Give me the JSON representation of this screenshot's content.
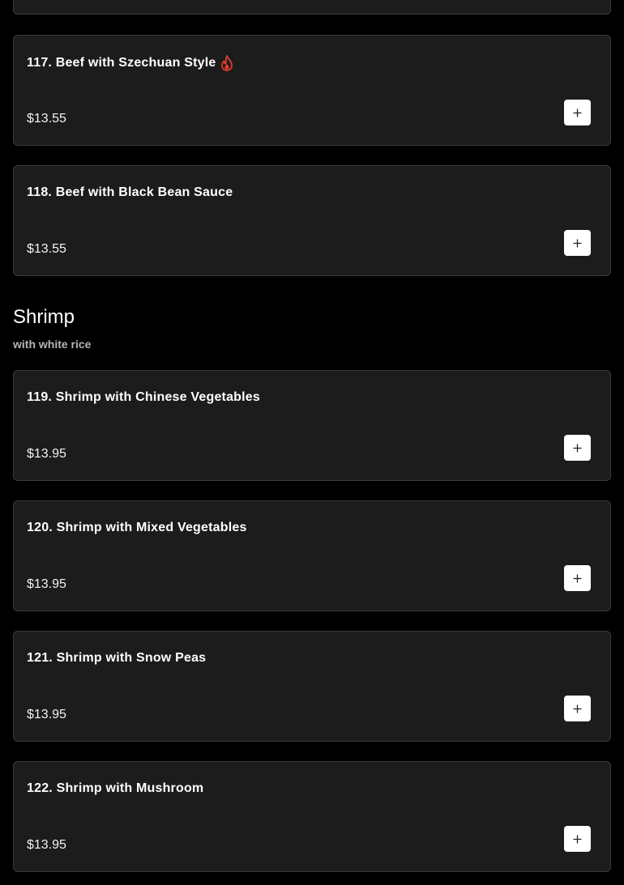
{
  "items": [
    {
      "name": "117. Beef with Szechuan Style",
      "price": "$13.55",
      "spicy": true
    },
    {
      "name": "118. Beef with Black Bean Sauce",
      "price": "$13.55",
      "spicy": false
    },
    {
      "name": "119. Shrimp with Chinese Vegetables",
      "price": "$13.95",
      "spicy": false
    },
    {
      "name": "120. Shrimp with Mixed Vegetables",
      "price": "$13.95",
      "spicy": false
    },
    {
      "name": "121. Shrimp with Snow Peas",
      "price": "$13.95",
      "spicy": false
    },
    {
      "name": "122. Shrimp with Mushroom",
      "price": "$13.95",
      "spicy": false
    }
  ],
  "section": {
    "title": "Shrimp",
    "subtitle": "with white rice"
  },
  "icons": {
    "add": "plus-icon",
    "spicy": "fire-icon"
  },
  "colors": {
    "background": "#000000",
    "card": "#1c1c1c",
    "card_border": "#3a3a3a",
    "spicy": "#e23b2e",
    "add_button": "#ffffff"
  }
}
